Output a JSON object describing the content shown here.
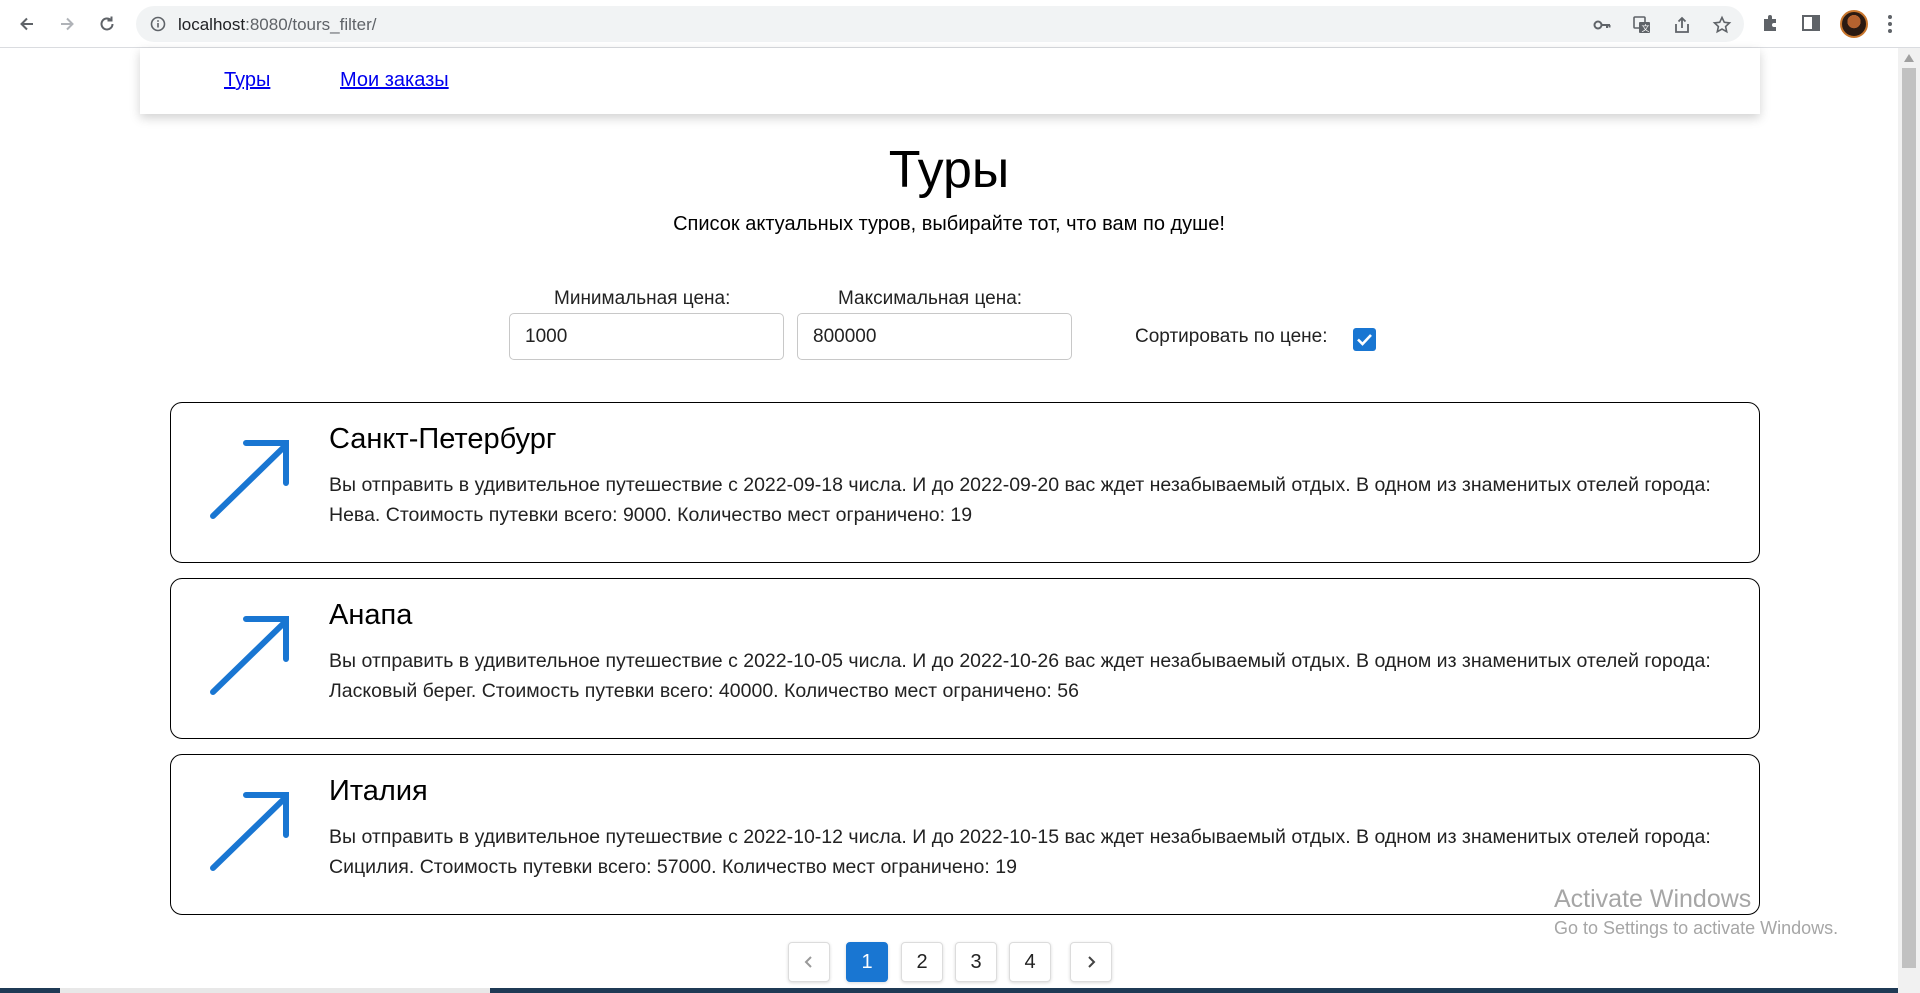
{
  "browser": {
    "url_host": "localhost",
    "url_path": ":8080/tours_filter/"
  },
  "nav": {
    "tours_link": "Туры",
    "orders_link": "Мои заказы"
  },
  "page": {
    "title": "Туры",
    "subtitle": "Список актуальных туров, выбирайте тот, что вам по душе!"
  },
  "filters": {
    "min_price_label": "Минимальная цена:",
    "min_price_value": "1000",
    "max_price_label": "Максимальная цена:",
    "max_price_value": "800000",
    "sort_label": "Сортировать по цене:",
    "sort_checked": true
  },
  "tours": [
    {
      "name": "Санкт-Петербург",
      "description": "Вы отправить в удивительное путешествие с 2022-09-18 числа. И до 2022-09-20 вас ждет незабываемый отдых. В одном из знаменитых отелей города: Нева. Стоимость путевки всего: 9000. Количество мест ограничено: 19"
    },
    {
      "name": "Анапа",
      "description": "Вы отправить в удивительное путешествие с 2022-10-05 числа. И до 2022-10-26 вас ждет незабываемый отдых. В одном из знаменитых отелей города: Ласковый берег. Стоимость путевки всего: 40000. Количество мест ограничено: 56"
    },
    {
      "name": "Италия",
      "description": "Вы отправить в удивительное путешествие с 2022-10-12 числа. И до 2022-10-15 вас ждет незабываемый отдых. В одном из знаменитых отелей города: Сицилия. Стоимость путевки всего: 57000. Количество мест ограничено: 19"
    }
  ],
  "pagination": {
    "pages": [
      "1",
      "2",
      "3",
      "4"
    ],
    "current": "1"
  },
  "watermark": {
    "title": "Activate Windows",
    "subtitle": "Go to Settings to activate Windows."
  },
  "colors": {
    "accent": "#1976d2",
    "link": "#0000ee"
  },
  "icons": {
    "tour_icon": "arrow-up-right-icon"
  }
}
